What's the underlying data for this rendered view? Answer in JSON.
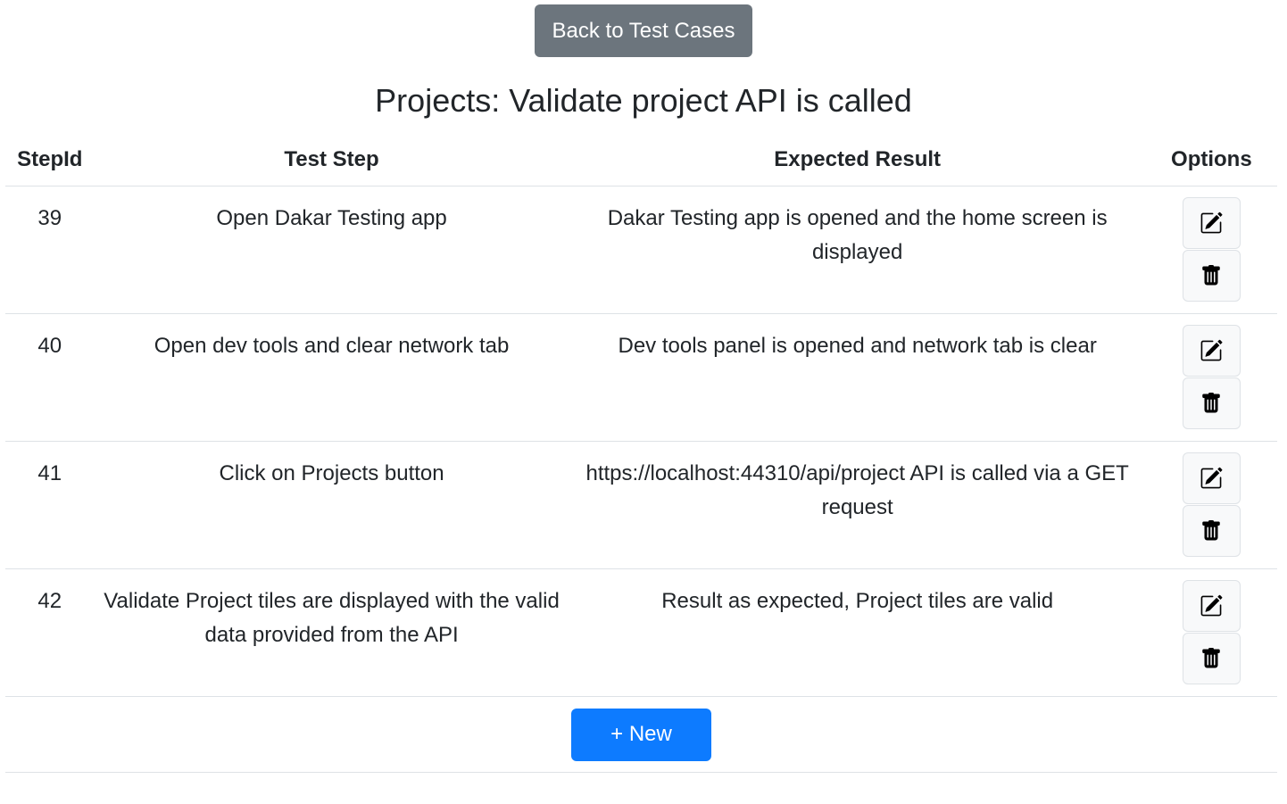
{
  "header": {
    "back_label": "Back to Test Cases",
    "title": "Projects: Validate project API is called"
  },
  "table": {
    "columns": [
      "StepId",
      "Test Step",
      "Expected Result",
      "Options"
    ],
    "rows": [
      {
        "id": "39",
        "step": "Open Dakar Testing app",
        "expected": "Dakar Testing app is opened and the home screen is displayed"
      },
      {
        "id": "40",
        "step": "Open dev tools and clear network tab",
        "expected": "Dev tools panel is opened and network tab is clear"
      },
      {
        "id": "41",
        "step": "Click on Projects button",
        "expected": "https://localhost:44310/api/project API is called via a GET request"
      },
      {
        "id": "42",
        "step": "Validate Project tiles are displayed with the valid data provided from the API",
        "expected": "Result as expected, Project tiles are valid"
      }
    ],
    "row_icons": {
      "edit": "edit-icon",
      "delete": "trash-icon"
    }
  },
  "footer": {
    "new_label": "+ New"
  },
  "colors": {
    "secondary": "#6c757d",
    "primary": "#0d7bff",
    "border": "#dee2e6",
    "light": "#f8f9fa"
  }
}
